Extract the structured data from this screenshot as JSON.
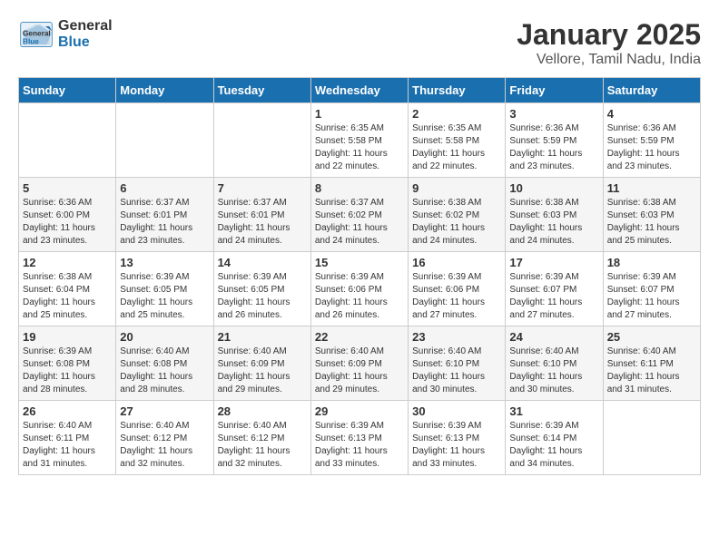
{
  "header": {
    "logo_line1": "General",
    "logo_line2": "Blue",
    "month": "January 2025",
    "location": "Vellore, Tamil Nadu, India"
  },
  "weekdays": [
    "Sunday",
    "Monday",
    "Tuesday",
    "Wednesday",
    "Thursday",
    "Friday",
    "Saturday"
  ],
  "weeks": [
    [
      {
        "day": "",
        "sunrise": "",
        "sunset": "",
        "daylight": ""
      },
      {
        "day": "",
        "sunrise": "",
        "sunset": "",
        "daylight": ""
      },
      {
        "day": "",
        "sunrise": "",
        "sunset": "",
        "daylight": ""
      },
      {
        "day": "1",
        "sunrise": "Sunrise: 6:35 AM",
        "sunset": "Sunset: 5:58 PM",
        "daylight": "Daylight: 11 hours and 22 minutes."
      },
      {
        "day": "2",
        "sunrise": "Sunrise: 6:35 AM",
        "sunset": "Sunset: 5:58 PM",
        "daylight": "Daylight: 11 hours and 22 minutes."
      },
      {
        "day": "3",
        "sunrise": "Sunrise: 6:36 AM",
        "sunset": "Sunset: 5:59 PM",
        "daylight": "Daylight: 11 hours and 23 minutes."
      },
      {
        "day": "4",
        "sunrise": "Sunrise: 6:36 AM",
        "sunset": "Sunset: 5:59 PM",
        "daylight": "Daylight: 11 hours and 23 minutes."
      }
    ],
    [
      {
        "day": "5",
        "sunrise": "Sunrise: 6:36 AM",
        "sunset": "Sunset: 6:00 PM",
        "daylight": "Daylight: 11 hours and 23 minutes."
      },
      {
        "day": "6",
        "sunrise": "Sunrise: 6:37 AM",
        "sunset": "Sunset: 6:01 PM",
        "daylight": "Daylight: 11 hours and 23 minutes."
      },
      {
        "day": "7",
        "sunrise": "Sunrise: 6:37 AM",
        "sunset": "Sunset: 6:01 PM",
        "daylight": "Daylight: 11 hours and 24 minutes."
      },
      {
        "day": "8",
        "sunrise": "Sunrise: 6:37 AM",
        "sunset": "Sunset: 6:02 PM",
        "daylight": "Daylight: 11 hours and 24 minutes."
      },
      {
        "day": "9",
        "sunrise": "Sunrise: 6:38 AM",
        "sunset": "Sunset: 6:02 PM",
        "daylight": "Daylight: 11 hours and 24 minutes."
      },
      {
        "day": "10",
        "sunrise": "Sunrise: 6:38 AM",
        "sunset": "Sunset: 6:03 PM",
        "daylight": "Daylight: 11 hours and 24 minutes."
      },
      {
        "day": "11",
        "sunrise": "Sunrise: 6:38 AM",
        "sunset": "Sunset: 6:03 PM",
        "daylight": "Daylight: 11 hours and 25 minutes."
      }
    ],
    [
      {
        "day": "12",
        "sunrise": "Sunrise: 6:38 AM",
        "sunset": "Sunset: 6:04 PM",
        "daylight": "Daylight: 11 hours and 25 minutes."
      },
      {
        "day": "13",
        "sunrise": "Sunrise: 6:39 AM",
        "sunset": "Sunset: 6:05 PM",
        "daylight": "Daylight: 11 hours and 25 minutes."
      },
      {
        "day": "14",
        "sunrise": "Sunrise: 6:39 AM",
        "sunset": "Sunset: 6:05 PM",
        "daylight": "Daylight: 11 hours and 26 minutes."
      },
      {
        "day": "15",
        "sunrise": "Sunrise: 6:39 AM",
        "sunset": "Sunset: 6:06 PM",
        "daylight": "Daylight: 11 hours and 26 minutes."
      },
      {
        "day": "16",
        "sunrise": "Sunrise: 6:39 AM",
        "sunset": "Sunset: 6:06 PM",
        "daylight": "Daylight: 11 hours and 27 minutes."
      },
      {
        "day": "17",
        "sunrise": "Sunrise: 6:39 AM",
        "sunset": "Sunset: 6:07 PM",
        "daylight": "Daylight: 11 hours and 27 minutes."
      },
      {
        "day": "18",
        "sunrise": "Sunrise: 6:39 AM",
        "sunset": "Sunset: 6:07 PM",
        "daylight": "Daylight: 11 hours and 27 minutes."
      }
    ],
    [
      {
        "day": "19",
        "sunrise": "Sunrise: 6:39 AM",
        "sunset": "Sunset: 6:08 PM",
        "daylight": "Daylight: 11 hours and 28 minutes."
      },
      {
        "day": "20",
        "sunrise": "Sunrise: 6:40 AM",
        "sunset": "Sunset: 6:08 PM",
        "daylight": "Daylight: 11 hours and 28 minutes."
      },
      {
        "day": "21",
        "sunrise": "Sunrise: 6:40 AM",
        "sunset": "Sunset: 6:09 PM",
        "daylight": "Daylight: 11 hours and 29 minutes."
      },
      {
        "day": "22",
        "sunrise": "Sunrise: 6:40 AM",
        "sunset": "Sunset: 6:09 PM",
        "daylight": "Daylight: 11 hours and 29 minutes."
      },
      {
        "day": "23",
        "sunrise": "Sunrise: 6:40 AM",
        "sunset": "Sunset: 6:10 PM",
        "daylight": "Daylight: 11 hours and 30 minutes."
      },
      {
        "day": "24",
        "sunrise": "Sunrise: 6:40 AM",
        "sunset": "Sunset: 6:10 PM",
        "daylight": "Daylight: 11 hours and 30 minutes."
      },
      {
        "day": "25",
        "sunrise": "Sunrise: 6:40 AM",
        "sunset": "Sunset: 6:11 PM",
        "daylight": "Daylight: 11 hours and 31 minutes."
      }
    ],
    [
      {
        "day": "26",
        "sunrise": "Sunrise: 6:40 AM",
        "sunset": "Sunset: 6:11 PM",
        "daylight": "Daylight: 11 hours and 31 minutes."
      },
      {
        "day": "27",
        "sunrise": "Sunrise: 6:40 AM",
        "sunset": "Sunset: 6:12 PM",
        "daylight": "Daylight: 11 hours and 32 minutes."
      },
      {
        "day": "28",
        "sunrise": "Sunrise: 6:40 AM",
        "sunset": "Sunset: 6:12 PM",
        "daylight": "Daylight: 11 hours and 32 minutes."
      },
      {
        "day": "29",
        "sunrise": "Sunrise: 6:39 AM",
        "sunset": "Sunset: 6:13 PM",
        "daylight": "Daylight: 11 hours and 33 minutes."
      },
      {
        "day": "30",
        "sunrise": "Sunrise: 6:39 AM",
        "sunset": "Sunset: 6:13 PM",
        "daylight": "Daylight: 11 hours and 33 minutes."
      },
      {
        "day": "31",
        "sunrise": "Sunrise: 6:39 AM",
        "sunset": "Sunset: 6:14 PM",
        "daylight": "Daylight: 11 hours and 34 minutes."
      },
      {
        "day": "",
        "sunrise": "",
        "sunset": "",
        "daylight": ""
      }
    ]
  ]
}
